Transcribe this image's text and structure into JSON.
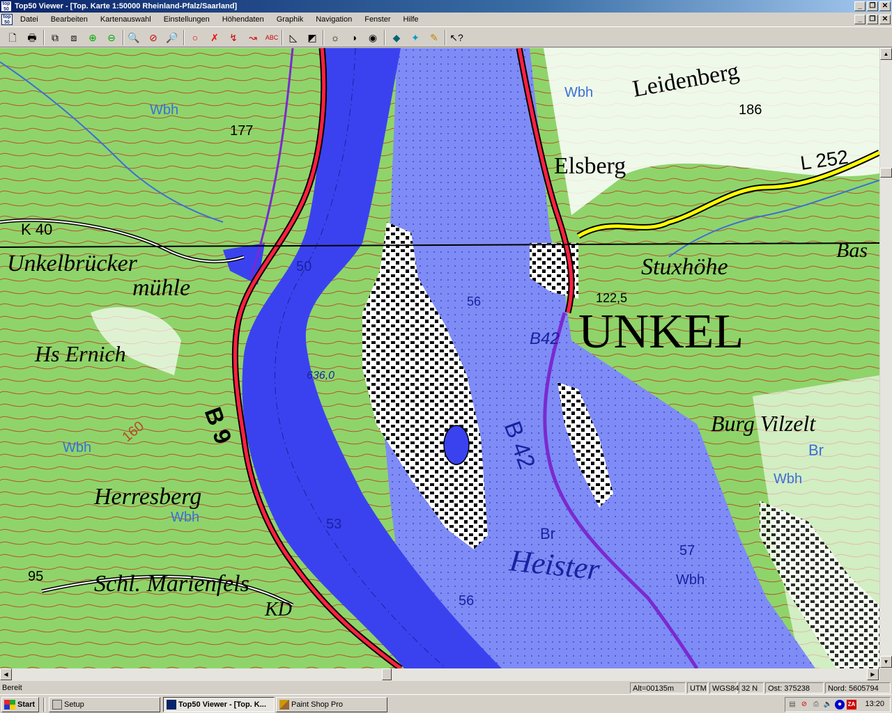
{
  "window": {
    "app_icon_text": "top 50",
    "title": "Top50 Viewer - [Top. Karte 1:50000 Rheinland-Pfalz/Saarland]"
  },
  "menu": {
    "doc_icon_text": "top 50",
    "items": [
      {
        "label": "Datei"
      },
      {
        "label": "Bearbeiten"
      },
      {
        "label": "Kartenauswahl"
      },
      {
        "label": "Einstellungen"
      },
      {
        "label": "Höhendaten"
      },
      {
        "label": "Graphik"
      },
      {
        "label": "Navigation"
      },
      {
        "label": "Fenster"
      },
      {
        "label": "Hilfe"
      }
    ]
  },
  "toolbar_icons": [
    "new-document-icon",
    "print-icon",
    "copy-map-icon",
    "paste-map-icon",
    "zoom-fit-icon",
    "zoom-window-icon",
    "zoom-in-icon",
    "zoom-disable-icon",
    "zoom-out-icon",
    "circle-icon",
    "delete-marker-icon",
    "measure-icon",
    "route-icon",
    "label-icon",
    "triangle-ruler-icon",
    "area-icon",
    "brightness-icon",
    "contrast-icon",
    "fill-icon",
    "layer-icon",
    "gps-icon",
    "track-icon",
    "help-pointer-icon"
  ],
  "map": {
    "labels": {
      "unkelbruecker": "Unkelbrücker",
      "muehle": "mühle",
      "hs_ernich": "Hs Ernich",
      "herresberg": "Herresberg",
      "schl_marienfels": "Schl. Marienfels",
      "kd": "KD",
      "b9": "B 9",
      "unkel": "UNKEL",
      "stuxhoehe": "Stuxhöhe",
      "leidenberg": "Leidenberg",
      "elsberg": "Elsberg",
      "burg_vilzelt": "Burg Vilzelt",
      "heister": "Heister",
      "b42": "B 42",
      "l252": "L 252",
      "b42_small": "B42",
      "bas": "Bas",
      "wbh": "Wbh",
      "br": "Br",
      "k40": "K 40",
      "h177": "177",
      "h186": "186",
      "h160": "160",
      "h95": "95",
      "h50": "50",
      "h53": "53",
      "h56": "56",
      "h57": "57",
      "h56b": "56",
      "h122": "122,5",
      "km636": "636,0"
    }
  },
  "status": {
    "ready": "Bereit",
    "alt": "Alt=00135m",
    "utm": "UTM",
    "datum": "WGS84",
    "zone": "32 N",
    "ost": "Ost:  375238",
    "nord": "Nord: 5605794"
  },
  "taskbar": {
    "start": "Start",
    "tasks": [
      {
        "label": "Setup"
      },
      {
        "label": "Top50 Viewer - [Top. K..."
      },
      {
        "label": "Paint Shop Pro"
      }
    ],
    "clock": "13:20"
  }
}
